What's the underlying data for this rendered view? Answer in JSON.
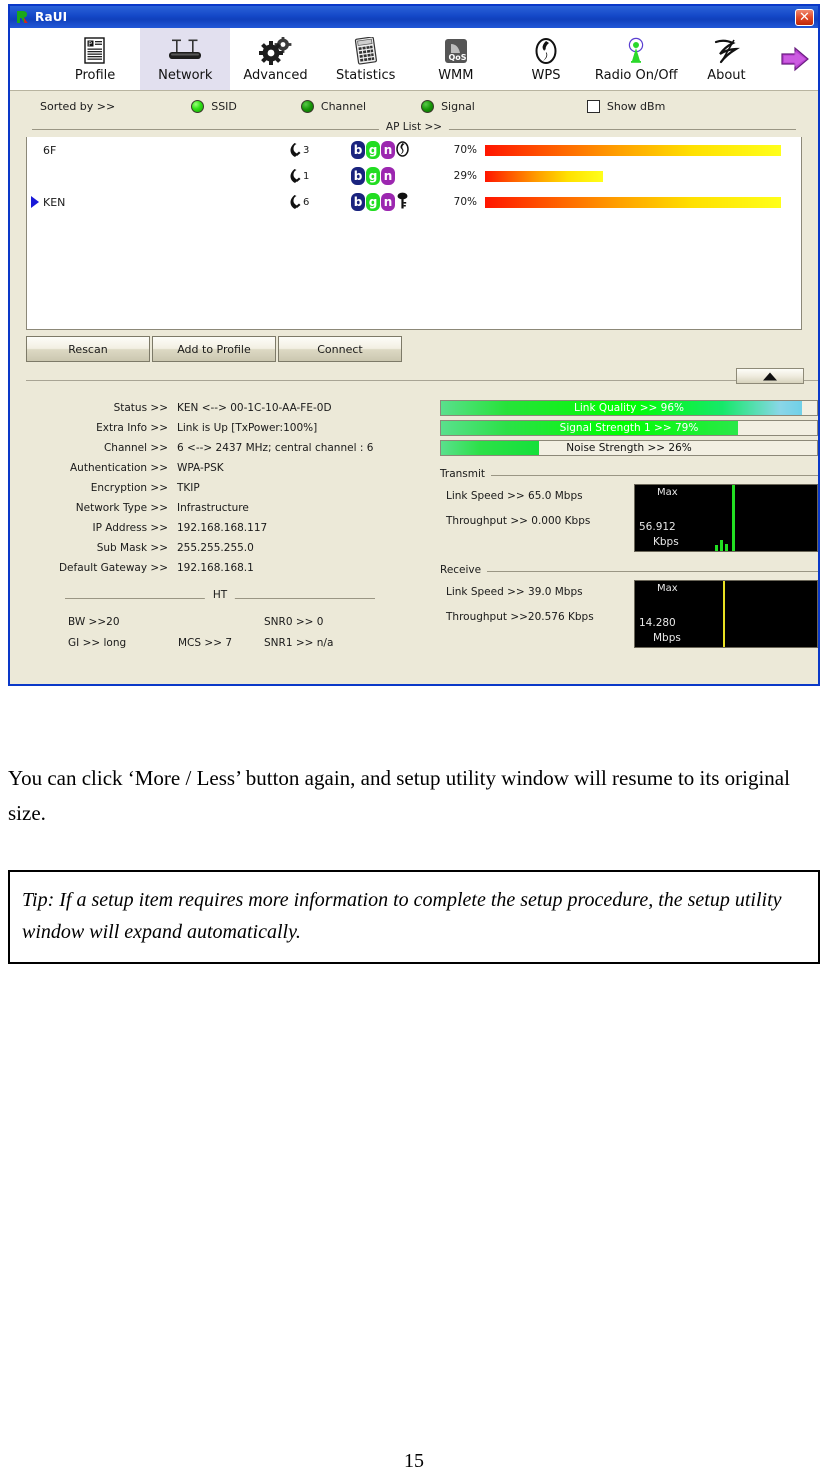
{
  "window": {
    "title": "RaUI",
    "close_label": "✕",
    "logo_icon": "raui-logo-icon"
  },
  "toolbar": {
    "items": [
      {
        "label": "Profile",
        "icon": "profile-icon",
        "active": false
      },
      {
        "label": "Network",
        "icon": "network-router-icon",
        "active": true
      },
      {
        "label": "Advanced",
        "icon": "gears-icon",
        "active": false
      },
      {
        "label": "Statistics",
        "icon": "calculator-icon",
        "active": false
      },
      {
        "label": "WMM",
        "icon": "qos-icon",
        "active": false
      },
      {
        "label": "WPS",
        "icon": "wps-icon",
        "active": false
      },
      {
        "label": "Radio On/Off",
        "icon": "radio-antenna-icon",
        "active": false
      },
      {
        "label": "About",
        "icon": "about-icon",
        "active": false
      }
    ],
    "expand_icon": "arrow-right-icon"
  },
  "sortbar": {
    "label": "Sorted by >>",
    "options": [
      {
        "label": "SSID",
        "selected": true
      },
      {
        "label": "Channel",
        "selected": false
      },
      {
        "label": "Signal",
        "selected": false
      }
    ],
    "show_dbm_label": "Show dBm",
    "show_dbm_checked": false
  },
  "ap_list": {
    "caption": "AP List >>",
    "rows": [
      {
        "ssid": "6F",
        "channel": "3",
        "caps": [
          "b",
          "g",
          "n"
        ],
        "extra_icon": "wps-small-icon",
        "signal_pct": "70%",
        "signal_value": 70,
        "selected": false
      },
      {
        "ssid": "",
        "channel": "1",
        "caps": [
          "b",
          "g",
          "n"
        ],
        "extra_icon": "",
        "signal_pct": "29%",
        "signal_value": 29,
        "selected": false
      },
      {
        "ssid": "KEN",
        "channel": "6",
        "caps": [
          "b",
          "g",
          "n"
        ],
        "extra_icon": "key-icon",
        "signal_pct": "70%",
        "signal_value": 70,
        "selected": true
      }
    ]
  },
  "buttons": {
    "rescan": "Rescan",
    "add_to_profile": "Add to Profile",
    "connect": "Connect",
    "more_less_icon": "triangle-up-icon"
  },
  "status": {
    "rows": [
      {
        "key": "Status >>",
        "value": "KEN <--> 00-1C-10-AA-FE-0D"
      },
      {
        "key": "Extra Info >>",
        "value": "Link is Up [TxPower:100%]"
      },
      {
        "key": "Channel >>",
        "value": "6 <--> 2437 MHz; central channel : 6"
      },
      {
        "key": "Authentication >>",
        "value": "WPA-PSK"
      },
      {
        "key": "Encryption >>",
        "value": "TKIP"
      },
      {
        "key": "Network Type >>",
        "value": "Infrastructure"
      },
      {
        "key": "IP Address >>",
        "value": "192.168.168.117"
      },
      {
        "key": "Sub Mask >>",
        "value": "255.255.255.0"
      },
      {
        "key": "Default Gateway >>",
        "value": "192.168.168.1"
      }
    ]
  },
  "ht": {
    "caption": "HT",
    "bw": "BW >>20",
    "snr0": "SNR0 >>  0",
    "gi": "GI >> long",
    "mcs": "MCS >>  7",
    "snr1": "SNR1 >> n/a"
  },
  "quality": {
    "link_quality": {
      "label": "Link Quality >> 96%",
      "value": 96
    },
    "signal_strength": {
      "label": "Signal Strength 1 >> 79%",
      "value": 79
    },
    "noise_strength": {
      "label": "Noise Strength >> 26%",
      "value": 26
    }
  },
  "transmit": {
    "section": "Transmit",
    "link_speed": "Link Speed >>  65.0 Mbps",
    "throughput": "Throughput >> 0.000 Kbps",
    "graph": {
      "max_label": "Max",
      "value": "56.912",
      "unit": "Kbps",
      "color": "#22e022"
    }
  },
  "receive": {
    "section": "Receive",
    "link_speed": "Link Speed >> 39.0 Mbps",
    "throughput": "Throughput >>20.576 Kbps",
    "graph": {
      "max_label": "Max",
      "value": "14.280",
      "unit": "Mbps",
      "color": "#e8e022"
    }
  },
  "document": {
    "paragraph": "You can click ‘More / Less’ button again, and setup utility window will resume to its original size.",
    "tip": "Tip: If a setup item requires more information to complete the setup procedure, the setup utility window will expand automatically.",
    "page_number": "15"
  }
}
